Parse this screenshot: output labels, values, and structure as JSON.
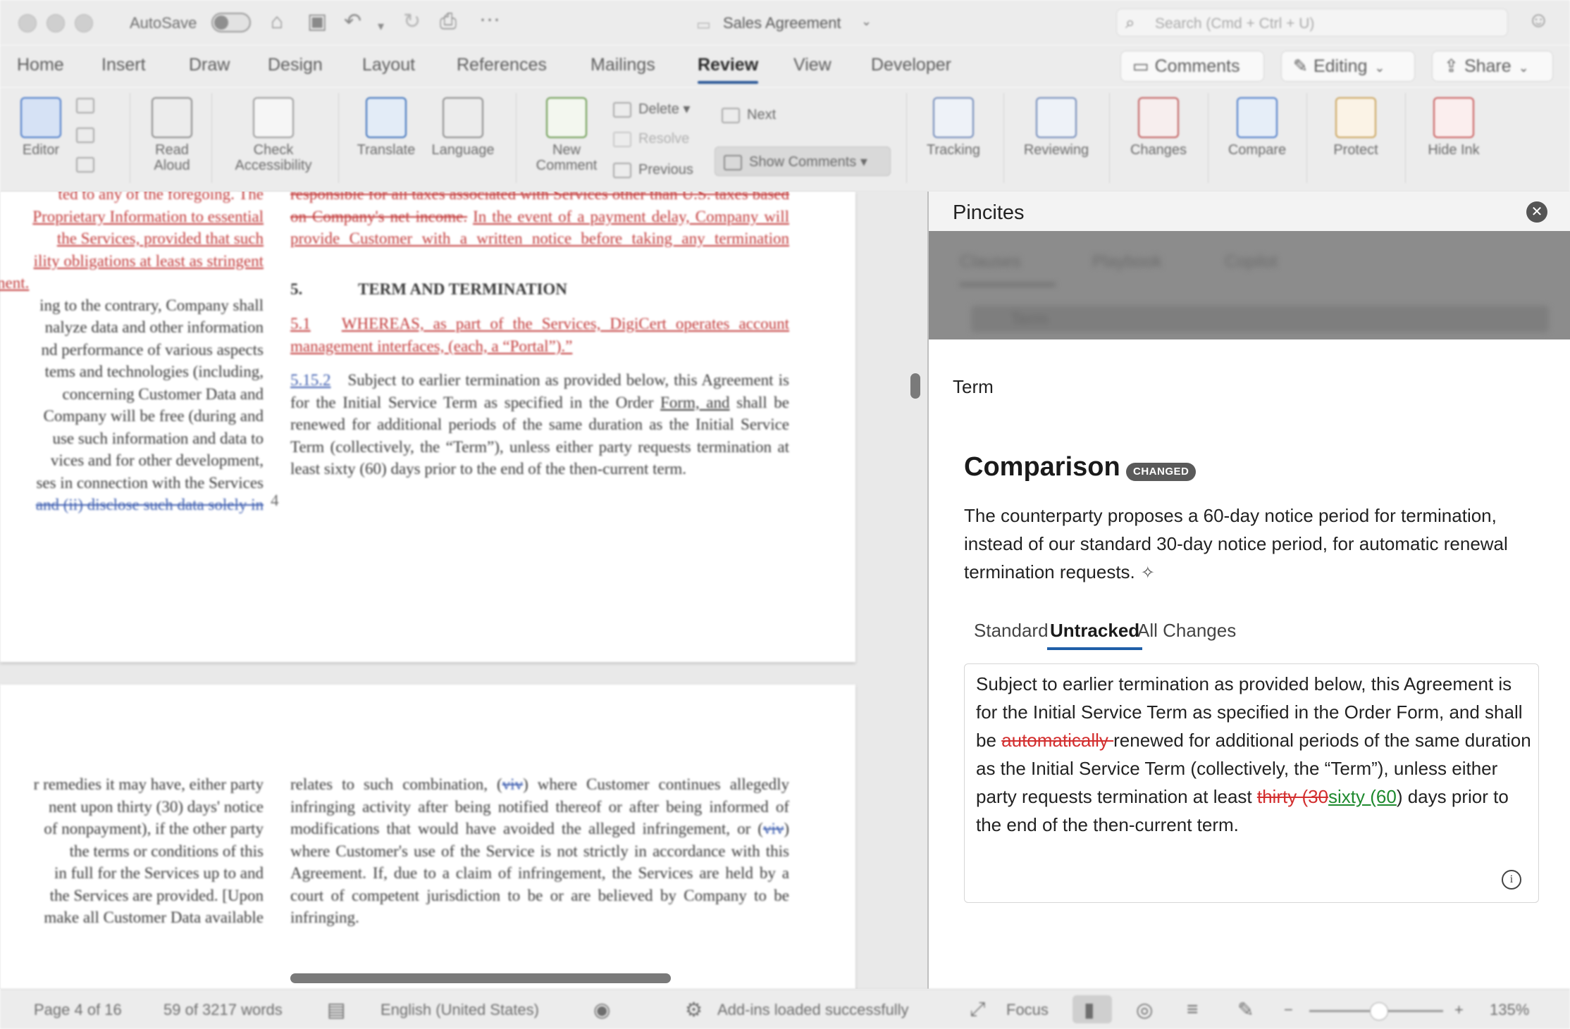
{
  "titlebar": {
    "autosave_label": "AutoSave",
    "doc_title": "Sales Agreement",
    "search_placeholder": "Search (Cmd + Ctrl + U)"
  },
  "tabs": [
    "Home",
    "Insert",
    "Draw",
    "Design",
    "Layout",
    "References",
    "Mailings",
    "Review",
    "View",
    "Developer"
  ],
  "active_tab": "Review",
  "header_buttons": {
    "comments": "Comments",
    "editing": "Editing",
    "share": "Share"
  },
  "ribbon": {
    "editor": "Editor",
    "read_aloud_1": "Read",
    "read_aloud_2": "Aloud",
    "check_1": "Check",
    "check_2": "Accessibility",
    "translate": "Translate",
    "language": "Language",
    "new_comment_1": "New",
    "new_comment_2": "Comment",
    "delete": "Delete",
    "resolve": "Resolve",
    "previous": "Previous",
    "next": "Next",
    "show_comments": "Show Comments",
    "tracking": "Tracking",
    "reviewing": "Reviewing",
    "changes": "Changes",
    "compare": "Compare",
    "protect": "Protect",
    "hide_ink": "Hide Ink"
  },
  "document": {
    "left_top": [
      "ted to any of the foregoing. The",
      "Proprietary Information to essential",
      "the Services, provided that such",
      "ility obligations at least as stringent",
      "nent.",
      "ing to the contrary, Company shall",
      "nalyze data and other information",
      "nd performance of various aspects",
      "tems and technologies (including,",
      "concerning Customer Data and",
      "Company will be free (during and",
      "use such information and data to",
      "vices and for other development,",
      "ses in connection with the Services",
      "and (ii) disclose such data solely in"
    ],
    "right_red_1": "responsible for all taxes associated with Services other than U.S. taxes based on Company's net income.",
    "right_red_2": "In the event of a payment delay, Company will provide Customer with a written notice before taking any termination actions.",
    "heading_num": "5.",
    "heading": "TERM AND TERMINATION",
    "clause_51_num": "5.1",
    "clause_51": "WHEREAS, as part of the Services, DigiCert operates account management interfaces, (each, a “Portal”).”",
    "clause_52_num": "5.15.2",
    "clause_52_a": "Subject to earlier termination as provided below, this Agreement is for the Initial Service Term as specified in the Order ",
    "clause_52_form": "Form, and",
    "clause_52_b": " shall be renewed for additional periods of the same duration as the Initial Service Term (collectively, the “Term”), unless either party requests termination at least sixty (60) days prior to the end of the then-current term.",
    "page_number": "4",
    "left_bottom": [
      "r remedies it may have, either party",
      "nent upon thirty (30) days' notice",
      "of nonpayment), if the other party",
      "the terms or conditions of this",
      "in full for the Services up to and",
      "the Services are provided. [Upon",
      "make all Customer Data available"
    ],
    "right_bottom_a": "relates to such combination, (",
    "right_bottom_viv": "viv",
    "right_bottom_b": ") where Customer continues allegedly infringing activity after being notified thereof or after being informed of modifications that would have avoided the alleged infringement, or (",
    "right_bottom_viv2": "viv",
    "right_bottom_c": ") where Customer's use of the Service is not strictly in accordance with this Agreement. If, due to a claim of infringement, the Services are held by a court of competent jurisdiction to be or are believed by Company to be infringing."
  },
  "pane": {
    "title": "Pincites",
    "overlay_tabs": [
      "Clauses",
      "Playbook",
      "Copilot"
    ],
    "overlay_search": "Term",
    "term_label": "Term",
    "comparison_title": "Comparison",
    "badge": "CHANGED",
    "description": "The counterparty proposes a 60-day notice period for termination, instead of our standard 30-day notice period, for automatic renewal termination requests.",
    "view_tabs": [
      "Standard",
      "Untracked",
      "All Changes"
    ],
    "active_view_tab": "Untracked",
    "text_1": "Subject to earlier termination as provided below, this Agreement is for the Initial Service Term as specified in the Order Form, and shall be ",
    "text_del_1": "automatically ",
    "text_2": "renewed for additional periods of the same duration as the Initial Service Term (collectively, the “Term”), unless either party requests termination at least ",
    "text_del_2": "thirty (30",
    "text_ins_2": "sixty (60",
    "text_3": ") days prior to the end of the then-current term."
  },
  "statusbar": {
    "page": "Page 4 of 16",
    "words": "59 of 3217 words",
    "language": "English (United States)",
    "addins": "Add-ins loaded successfully",
    "focus": "Focus",
    "zoom": "135%"
  }
}
